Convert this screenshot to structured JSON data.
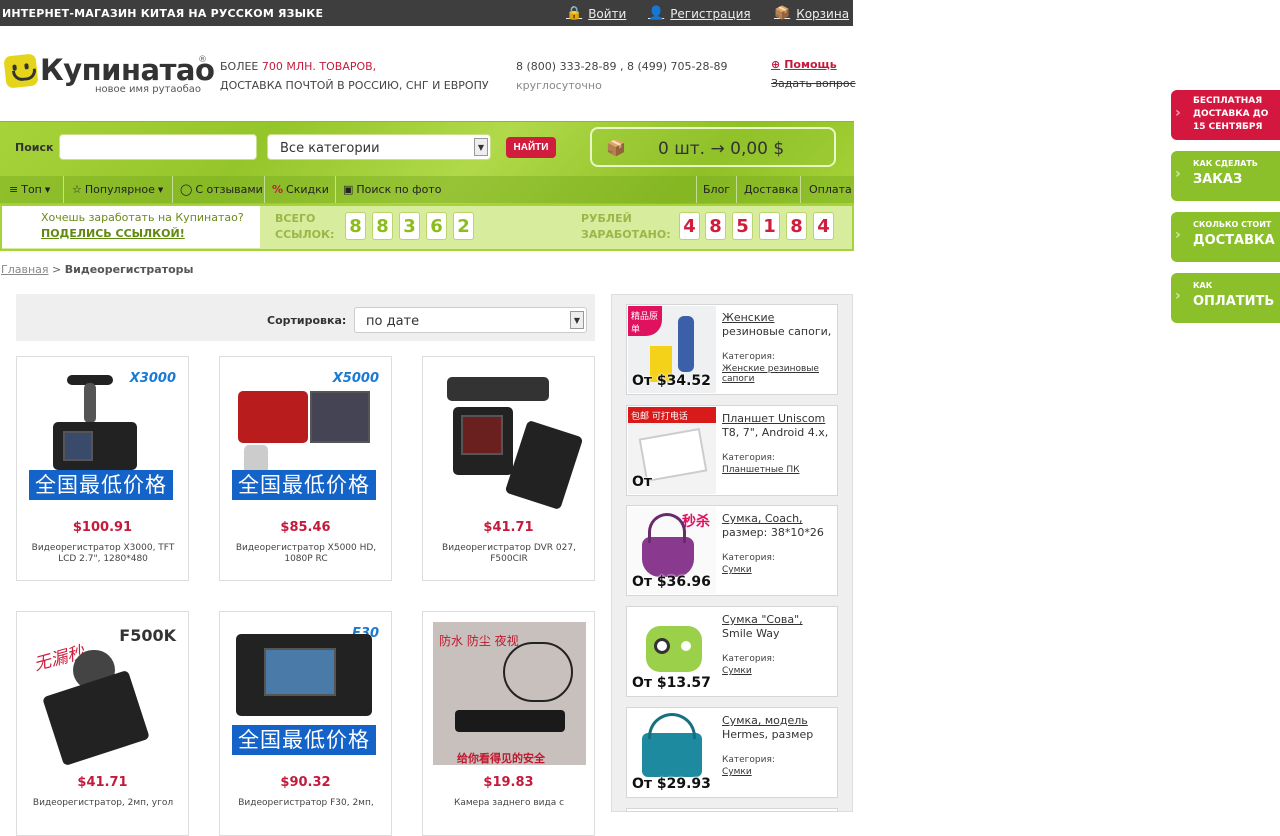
{
  "topbar": {
    "title": "ИНТЕРНЕТ-МАГАЗИН КИТАЯ НА РУССКОМ ЯЗЫКЕ",
    "login": "Войти",
    "register": "Регистрация",
    "cart": "Корзина"
  },
  "header": {
    "logo_name": "Купинатао",
    "logo_reg": "®",
    "logo_sub": "новое имя рутаобао",
    "info_line1_prefix": "БОЛЕЕ ",
    "info_line1_count": "700 МЛН. ТОВАРОВ,",
    "info_line2": "ДОСТАВКА ПОЧТОЙ В РОССИЮ, СНГ И ЕВРОПУ",
    "phones": "8 (800) 333-28-89 , 8 (499) 705-28-89",
    "hours": "круглосуточно",
    "help": "Помощь",
    "ask": "Задать вопрос"
  },
  "search": {
    "label": "Поиск",
    "placeholder": "",
    "category": "Все категории",
    "button": "НАЙТИ",
    "cart_summary": "0 шт. → 0,00 $"
  },
  "nav": {
    "left": [
      "Топ",
      "Популярное",
      "С отзывами",
      "Скидки",
      "Поиск по фото"
    ],
    "right": [
      "Блог",
      "Доставка",
      "Оплата"
    ]
  },
  "referral": {
    "text": "Хочешь заработать на Купинатао?",
    "link": "ПОДЕЛИСЬ ССЫЛКОЙ!",
    "links_label_1": "ВСЕГО",
    "links_label_2": "ССЫЛОК:",
    "links_digits": [
      "8",
      "8",
      "3",
      "6",
      "2"
    ],
    "earned_label_1": "РУБЛЕЙ",
    "earned_label_2": "ЗАРАБОТАНО:",
    "earned_digits": [
      "4",
      "8",
      "5",
      "1",
      "8",
      "4"
    ]
  },
  "breadcrumb": {
    "home": "Главная",
    "sep": " > ",
    "current": "Видеорегистраторы"
  },
  "sort": {
    "label": "Сортировка:",
    "value": "по дате"
  },
  "products": [
    {
      "model": "X3000",
      "badge": "全国最低价格",
      "price": "$100.91",
      "desc": "Видеорегистратор X3000, TFT LCD 2.7\", 1280*480"
    },
    {
      "model": "X5000",
      "badge": "全国最低价格",
      "price": "$85.46",
      "desc": "Видеорегистратор X5000 HD, 1080P RC"
    },
    {
      "model": "",
      "badge": "",
      "price": "$41.71",
      "desc": "Видеорегистратор DVR 027, F500CIR"
    },
    {
      "model": "F500K",
      "badge": "",
      "promo": "无漏秒",
      "price": "$41.71",
      "desc": "Видеорегистратор, 2мп, угол"
    },
    {
      "model": "F30",
      "badge": "全国最低价格",
      "price": "$90.32",
      "desc": "Видеорегистратор F30, 2мп,"
    },
    {
      "model": "",
      "badge": "",
      "promo": "防水 防尘 夜视",
      "promo2": "给你看得见的安全",
      "price": "$19.83",
      "desc": "Камера заднего вида с"
    }
  ],
  "sidebar": [
    {
      "price": "От $34.52",
      "title": "Женские",
      "title2": "резиновые сапоги,",
      "cat_label": "Категория:",
      "cat": "Женские резиновые сапоги",
      "tag": "精品原单"
    },
    {
      "price": "От",
      "title": "Планшет Uniscom",
      "title2": "T8, 7\", Android 4.x,",
      "cat_label": "Категория:",
      "cat": "Планшетные ПК",
      "tag": "包邮  可打电话"
    },
    {
      "price": "От $36.96",
      "title": "Сумка, Coach,",
      "title2": "размер: 38*10*26",
      "cat_label": "Категория:",
      "cat": "Сумки",
      "tag": "秒杀"
    },
    {
      "price": "От $13.57",
      "title": "Сумка \"Сова\",",
      "title2": "Smile Way",
      "cat_label": "Категория:",
      "cat": "Сумки",
      "tag": ""
    },
    {
      "price": "От $29.93",
      "title": "Сумка, модель",
      "title2": "Hermes, размер",
      "cat_label": "Категория:",
      "cat": "Сумки",
      "tag": ""
    }
  ],
  "promos": [
    {
      "line1": "БЕСПЛАТНАЯ ДОСТАВКА ДО 15 СЕНТЯБРЯ",
      "line2": ""
    },
    {
      "line1": "КАК СДЕЛАТЬ",
      "line2": "ЗАКАЗ"
    },
    {
      "line1": "СКОЛЬКО СТОИТ",
      "line2": "ДОСТАВКА"
    },
    {
      "line1": "КАК",
      "line2": "ОПЛАТИТЬ"
    }
  ],
  "colors": {
    "accent_green": "#a7d33a",
    "accent_red": "#d01d3d",
    "topbar": "#3e3e3e"
  }
}
